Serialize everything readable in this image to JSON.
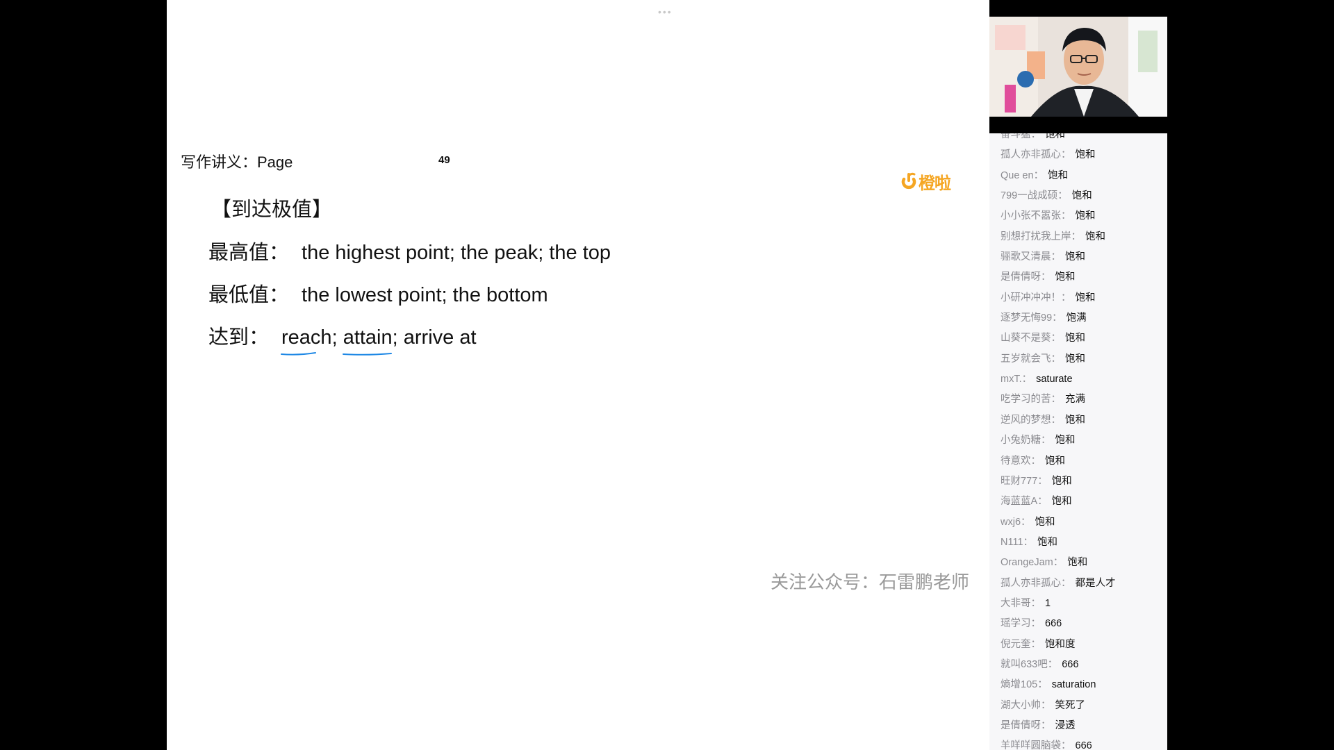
{
  "slide": {
    "dots": "•••",
    "header": "写作讲义：Page",
    "page_number": "49",
    "logo_text": "橙啦",
    "section_title": "【到达极值】",
    "lines": [
      {
        "label": "最高值：",
        "value": "the highest point; the peak; the top"
      },
      {
        "label": "最低值：",
        "value": "the lowest point; the bottom"
      },
      {
        "label": "达到：",
        "value_parts": [
          "reach",
          "; ",
          "attain",
          "; arrive at"
        ]
      }
    ],
    "watermark": "关注公众号：石雷鹏老师",
    "colors": {
      "logo": "#f5a623",
      "underline": "#1e88e5",
      "watermark": "#9a9a9a"
    }
  },
  "chat": {
    "messages": [
      {
        "user": "奋斗猛：",
        "text": "饱和"
      },
      {
        "user": "孤人亦非孤心：",
        "text": "饱和"
      },
      {
        "user": "Que en：",
        "text": "饱和"
      },
      {
        "user": "799一战成硕：",
        "text": "饱和"
      },
      {
        "user": "小小张不嚣张：",
        "text": "饱和"
      },
      {
        "user": "别想打扰我上岸：",
        "text": "饱和"
      },
      {
        "user": "骊歌又清晨：",
        "text": "饱和"
      },
      {
        "user": "是倩倩呀：",
        "text": "饱和"
      },
      {
        "user": "小研冲冲冲！：",
        "text": "饱和"
      },
      {
        "user": "逐梦无悔99：",
        "text": "饱满"
      },
      {
        "user": "山葵不是葵：",
        "text": "饱和"
      },
      {
        "user": "五岁就会飞：",
        "text": "饱和"
      },
      {
        "user": "mxT.：",
        "text": "saturate"
      },
      {
        "user": "吃学习的苦：",
        "text": "充满"
      },
      {
        "user": "逆风的梦想：",
        "text": "饱和"
      },
      {
        "user": "小兔奶糖：",
        "text": "饱和"
      },
      {
        "user": "待意欢：",
        "text": "饱和"
      },
      {
        "user": "旺财777：",
        "text": "饱和"
      },
      {
        "user": "海蓝蓝A：",
        "text": "饱和"
      },
      {
        "user": "wxj6：",
        "text": "饱和"
      },
      {
        "user": "N111：",
        "text": "饱和"
      },
      {
        "user": "OrangeJam：",
        "text": "饱和"
      },
      {
        "user": "孤人亦非孤心：",
        "text": "都是人才"
      },
      {
        "user": "大非哥：",
        "text": "1"
      },
      {
        "user": "瑶学习：",
        "text": "666"
      },
      {
        "user": "倪元奎：",
        "text": "饱和度"
      },
      {
        "user": "就叫633吧：",
        "text": "666"
      },
      {
        "user": "熵增105：",
        "text": "saturation"
      },
      {
        "user": "湖大小帅：",
        "text": "笑死了"
      },
      {
        "user": "是倩倩呀：",
        "text": "浸透"
      },
      {
        "user": "羊咩咩圆脑袋：",
        "text": "666"
      }
    ]
  }
}
